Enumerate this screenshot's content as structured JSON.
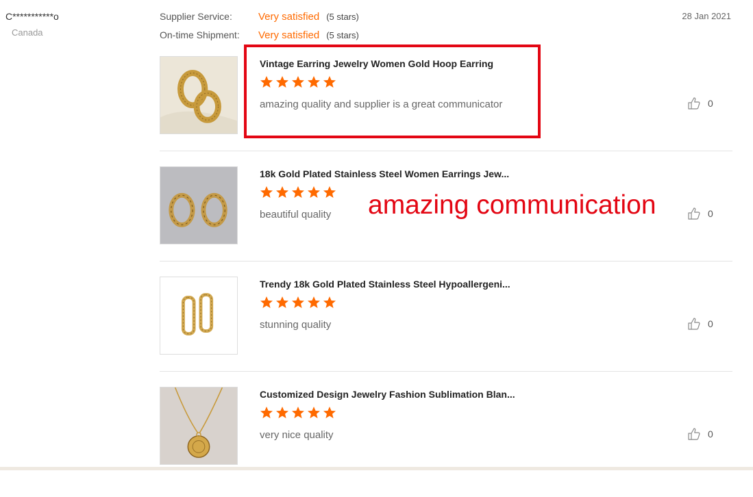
{
  "reviewer": {
    "name": "C***********o",
    "country": "Canada"
  },
  "date": "28 Jan 2021",
  "ratings": [
    {
      "label": "Supplier Service:",
      "value": "Very satisfied",
      "stars_text": "(5 stars)"
    },
    {
      "label": "On-time Shipment:",
      "value": "Very satisfied",
      "stars_text": "(5 stars)"
    }
  ],
  "reviews": [
    {
      "title": "Vintage Earring Jewelry Women Gold Hoop Earring",
      "stars": 5,
      "comment": "amazing quality and supplier is a great communicator",
      "likes": "0",
      "thumb": "earring-hoops-chunky"
    },
    {
      "title": "18k Gold Plated Stainless Steel Women Earrings Jew...",
      "stars": 5,
      "comment": "beautiful quality",
      "likes": "0",
      "thumb": "earring-hoops-twisted"
    },
    {
      "title": "Trendy 18k Gold Plated Stainless Steel Hypoallergeni...",
      "stars": 5,
      "comment": "stunning quality",
      "likes": "0",
      "thumb": "earring-rect-rope"
    },
    {
      "title": "Customized Design Jewelry Fashion Sublimation Blan...",
      "stars": 5,
      "comment": "very nice quality",
      "likes": "0",
      "thumb": "necklace-coin"
    }
  ],
  "annotation": "amazing communication",
  "colors": {
    "accent": "#ff6a00",
    "highlight": "#e30613"
  }
}
